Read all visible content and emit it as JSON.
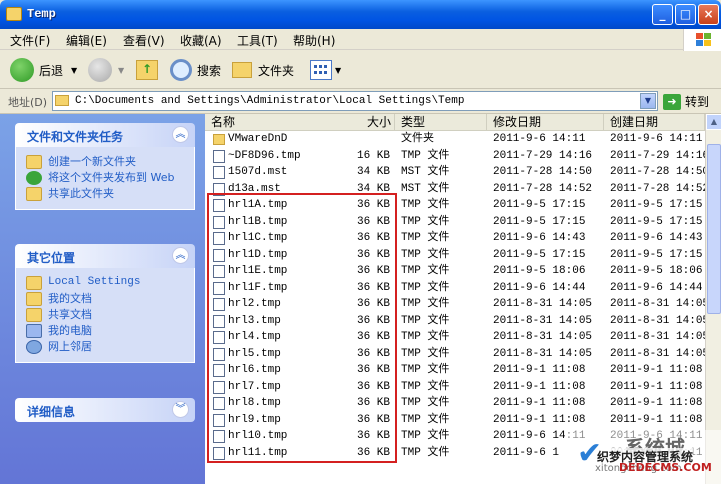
{
  "window": {
    "title": "Temp",
    "min": "_",
    "max": "□",
    "close": "×"
  },
  "menu": [
    "文件(F)",
    "编辑(E)",
    "查看(V)",
    "收藏(A)",
    "工具(T)",
    "帮助(H)"
  ],
  "toolbar": {
    "back": "后退",
    "search": "搜索",
    "folders": "文件夹"
  },
  "address": {
    "label": "地址(D)",
    "value": "C:\\Documents and Settings\\Administrator\\Local Settings\\Temp",
    "go": "转到"
  },
  "tasks": {
    "title": "文件和文件夹任务",
    "items": [
      "创建一个新文件夹",
      "将这个文件夹发布到 Web",
      "共享此文件夹"
    ]
  },
  "places": {
    "title": "其它位置",
    "items": [
      "Local Settings",
      "我的文档",
      "共享文档",
      "我的电脑",
      "网上邻居"
    ]
  },
  "details": {
    "title": "详细信息"
  },
  "columns": {
    "name": "名称",
    "size": "大小",
    "type": "类型",
    "modified": "修改日期",
    "created": "创建日期"
  },
  "files": [
    {
      "name": "VMwareDnD",
      "size": "",
      "type": "文件夹",
      "modified": "2011-9-6 14:11",
      "created": "2011-9-6 14:11",
      "folder": true
    },
    {
      "name": "~DF8D96.tmp",
      "size": "16 KB",
      "type": "TMP 文件",
      "modified": "2011-7-29 14:16",
      "created": "2011-7-29 14:16"
    },
    {
      "name": "1507d.mst",
      "size": "34 KB",
      "type": "MST 文件",
      "modified": "2011-7-28 14:50",
      "created": "2011-7-28 14:50"
    },
    {
      "name": "d13a.mst",
      "size": "34 KB",
      "type": "MST 文件",
      "modified": "2011-7-28 14:52",
      "created": "2011-7-28 14:52"
    },
    {
      "name": "hrl1A.tmp",
      "size": "36 KB",
      "type": "TMP 文件",
      "modified": "2011-9-5 17:15",
      "created": "2011-9-5 17:15"
    },
    {
      "name": "hrl1B.tmp",
      "size": "36 KB",
      "type": "TMP 文件",
      "modified": "2011-9-5 17:15",
      "created": "2011-9-5 17:15"
    },
    {
      "name": "hrl1C.tmp",
      "size": "36 KB",
      "type": "TMP 文件",
      "modified": "2011-9-6 14:43",
      "created": "2011-9-6 14:43"
    },
    {
      "name": "hrl1D.tmp",
      "size": "36 KB",
      "type": "TMP 文件",
      "modified": "2011-9-5 17:15",
      "created": "2011-9-5 17:15"
    },
    {
      "name": "hrl1E.tmp",
      "size": "36 KB",
      "type": "TMP 文件",
      "modified": "2011-9-5 18:06",
      "created": "2011-9-5 18:06"
    },
    {
      "name": "hrl1F.tmp",
      "size": "36 KB",
      "type": "TMP 文件",
      "modified": "2011-9-6 14:44",
      "created": "2011-9-6 14:44"
    },
    {
      "name": "hrl2.tmp",
      "size": "36 KB",
      "type": "TMP 文件",
      "modified": "2011-8-31 14:05",
      "created": "2011-8-31 14:05"
    },
    {
      "name": "hrl3.tmp",
      "size": "36 KB",
      "type": "TMP 文件",
      "modified": "2011-8-31 14:05",
      "created": "2011-8-31 14:05"
    },
    {
      "name": "hrl4.tmp",
      "size": "36 KB",
      "type": "TMP 文件",
      "modified": "2011-8-31 14:05",
      "created": "2011-8-31 14:05"
    },
    {
      "name": "hrl5.tmp",
      "size": "36 KB",
      "type": "TMP 文件",
      "modified": "2011-8-31 14:05",
      "created": "2011-8-31 14:05"
    },
    {
      "name": "hrl6.tmp",
      "size": "36 KB",
      "type": "TMP 文件",
      "modified": "2011-9-1 11:08",
      "created": "2011-9-1 11:08"
    },
    {
      "name": "hrl7.tmp",
      "size": "36 KB",
      "type": "TMP 文件",
      "modified": "2011-9-1 11:08",
      "created": "2011-9-1 11:08"
    },
    {
      "name": "hrl8.tmp",
      "size": "36 KB",
      "type": "TMP 文件",
      "modified": "2011-9-1 11:08",
      "created": "2011-9-1 11:08"
    },
    {
      "name": "hrl9.tmp",
      "size": "36 KB",
      "type": "TMP 文件",
      "modified": "2011-9-1 11:08",
      "created": "2011-9-1 11:08"
    },
    {
      "name": "hrl10.tmp",
      "size": "36 KB",
      "type": "TMP 文件",
      "modified": "2011-9-6 14:11",
      "created": "2011-9-6 14:11"
    },
    {
      "name": "hrl11.tmp",
      "size": "36 KB",
      "type": "TMP 文件",
      "modified": "2011-9-6 1",
      "created": "2011-9-6 14:11"
    }
  ],
  "watermark": {
    "brand": "系统城",
    "line1": "织梦内容管理系统",
    "line2": "xitongcheng.com",
    "line3": "DEDECMS.COM"
  },
  "colors": {
    "taskpane": "#7ba2e7",
    "link": "#215dc6",
    "highlight_box": "#d42020",
    "titlebar": "#0054e3"
  }
}
